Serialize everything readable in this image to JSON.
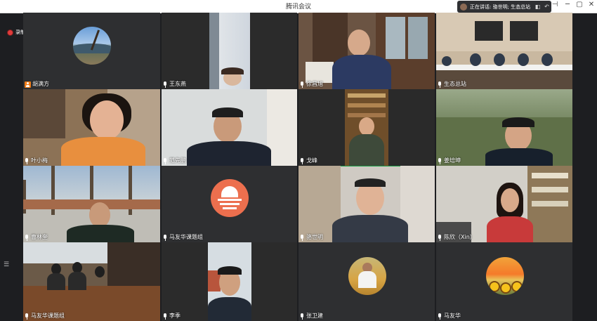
{
  "window": {
    "title": "腾讯会议"
  },
  "speaking": {
    "text": "正在讲话: 骆世明; 生态总站"
  },
  "recording": {
    "label": "录制中"
  },
  "participants": [
    {
      "name": "胡满方",
      "icon": "user-icon",
      "video": false,
      "avatar": "mountain-landscape"
    },
    {
      "name": "王东燕",
      "icon": "mic-icon",
      "video": true
    },
    {
      "name": "徐昌旭",
      "icon": "mic-icon",
      "video": true
    },
    {
      "name": "生态总站",
      "icon": "mic-icon",
      "video": true
    },
    {
      "name": "叶小梅",
      "icon": "mic-icon",
      "video": true
    },
    {
      "name": "范先鹏",
      "icon": "mic-icon",
      "video": true
    },
    {
      "name": "戈峰",
      "icon": "mic-icon",
      "video": true
    },
    {
      "name": "姜培坤",
      "icon": "mic-icon",
      "video": true
    },
    {
      "name": "曹林奎",
      "icon": "mic-icon",
      "video": true
    },
    {
      "name": "马友华课题组",
      "icon": "mic-icon",
      "video": false,
      "avatar": "orange-logo"
    },
    {
      "name": "骆世明",
      "icon": "mic-icon",
      "video": true,
      "active": true
    },
    {
      "name": "陈欣（Xin）",
      "icon": "mic-icon",
      "video": true
    },
    {
      "name": "马友华课题组",
      "icon": "mic-icon",
      "video": true
    },
    {
      "name": "李季",
      "icon": "mic-icon",
      "video": true
    },
    {
      "name": "张卫建",
      "icon": "mic-icon",
      "video": false,
      "avatar": "wheat-field-person"
    },
    {
      "name": "马友华",
      "icon": "mic-icon",
      "video": false,
      "avatar": "sunflower-sunset"
    }
  ],
  "colors": {
    "active_border": "#1fa24a",
    "tile_bg": "#2e2f31",
    "record_dot": "#e03b3b"
  }
}
